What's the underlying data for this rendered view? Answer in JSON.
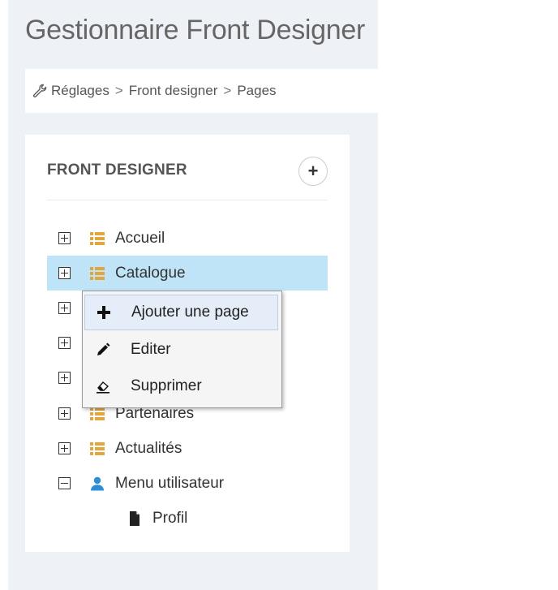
{
  "page": {
    "title": "Gestionnaire Front Designer",
    "colors": {
      "selected_row": "#bfe3f7",
      "folder_icon": "#e2a63b",
      "user_icon": "#2a8fd6"
    }
  },
  "breadcrumb": {
    "icon": "wrench-icon",
    "items": [
      "Réglages",
      "Front designer",
      "Pages"
    ],
    "separator": ">"
  },
  "portlet": {
    "title": "FRONT DESIGNER",
    "add_button": "+"
  },
  "tree": {
    "nodes": [
      {
        "label": "Accueil",
        "icon": "list-icon",
        "state": "collapsed"
      },
      {
        "label": "Catalogue",
        "icon": "list-icon",
        "state": "collapsed",
        "selected": true
      },
      {
        "label": "",
        "icon": "list-icon",
        "state": "collapsed"
      },
      {
        "label": "",
        "icon": "list-icon",
        "state": "collapsed"
      },
      {
        "label": "",
        "icon": "list-icon",
        "state": "collapsed"
      },
      {
        "label": "Partenaires",
        "icon": "list-icon",
        "state": "collapsed"
      },
      {
        "label": "Actualités",
        "icon": "list-icon",
        "state": "collapsed"
      },
      {
        "label": "Menu utilisateur",
        "icon": "user-icon",
        "state": "expanded"
      }
    ],
    "children": [
      {
        "label": "Profil",
        "icon": "file-icon"
      }
    ]
  },
  "context_menu": {
    "items": [
      {
        "label": "Ajouter une page",
        "icon": "plus-icon"
      },
      {
        "label": "Editer",
        "icon": "pencil-icon"
      },
      {
        "label": "Supprimer",
        "icon": "eraser-icon"
      }
    ]
  }
}
